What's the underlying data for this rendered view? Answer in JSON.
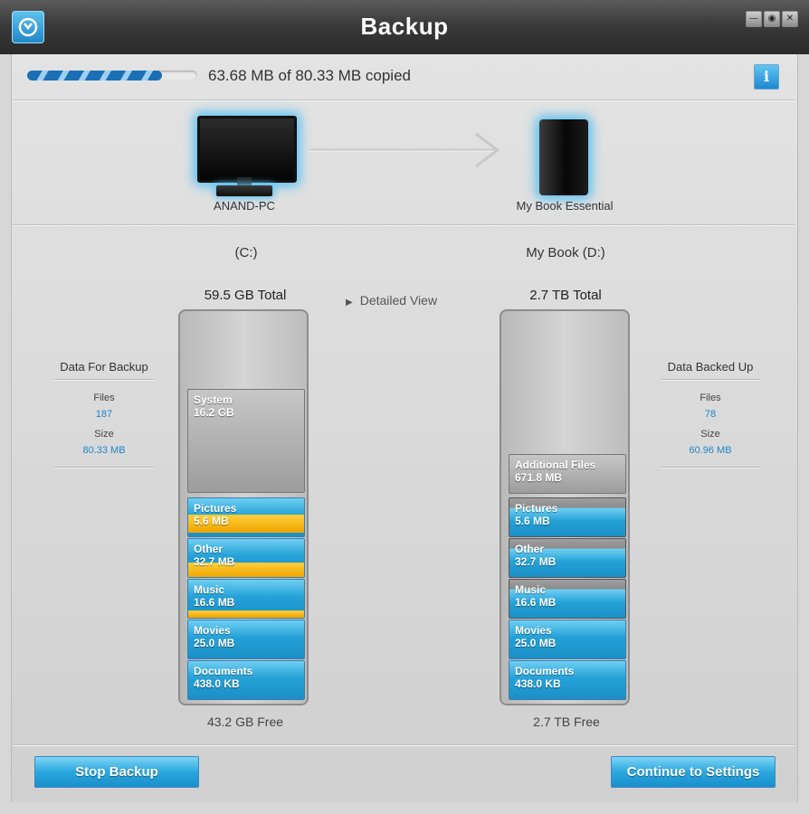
{
  "window": {
    "title": "Backup"
  },
  "window_controls": {
    "minimize": "—",
    "restore": "◉",
    "close": "✕"
  },
  "progress": {
    "text": "63.68 MB of 80.33 MB copied",
    "fraction": 0.79
  },
  "source": {
    "device_label": "ANAND-PC",
    "drive_label": "(C:)",
    "total": "59.5 GB Total",
    "free": "43.2 GB Free",
    "stats": {
      "heading": "Data For Backup",
      "files_label": "Files",
      "files_value": "187",
      "size_label": "Size",
      "size_value": "80.33 MB"
    },
    "segments": [
      {
        "name": "System",
        "size": "16.2 GB"
      },
      {
        "name": "Pictures",
        "size": "5.6 MB"
      },
      {
        "name": "Other",
        "size": "32.7 MB"
      },
      {
        "name": "Music",
        "size": "16.6 MB"
      },
      {
        "name": "Movies",
        "size": "25.0 MB"
      },
      {
        "name": "Documents",
        "size": "438.0 KB"
      }
    ]
  },
  "destination": {
    "device_label": "My Book Essential",
    "drive_label": "My Book (D:)",
    "total": "2.7 TB Total",
    "free": "2.7 TB Free",
    "stats": {
      "heading": "Data Backed Up",
      "files_label": "Files",
      "files_value": "78",
      "size_label": "Size",
      "size_value": "60.96 MB"
    },
    "segments": [
      {
        "name": "Additional Files",
        "size": "671.8 MB"
      },
      {
        "name": "Pictures",
        "size": "5.6 MB"
      },
      {
        "name": "Other",
        "size": "32.7 MB"
      },
      {
        "name": "Music",
        "size": "16.6 MB"
      },
      {
        "name": "Movies",
        "size": "25.0 MB"
      },
      {
        "name": "Documents",
        "size": "438.0 KB"
      }
    ]
  },
  "detailed_view": "Detailed View",
  "buttons": {
    "stop": "Stop Backup",
    "continue": "Continue to Settings"
  },
  "colors": {
    "accent": "#24a1d7",
    "highlight": "#f0a500",
    "glow": "#58c1f2"
  }
}
